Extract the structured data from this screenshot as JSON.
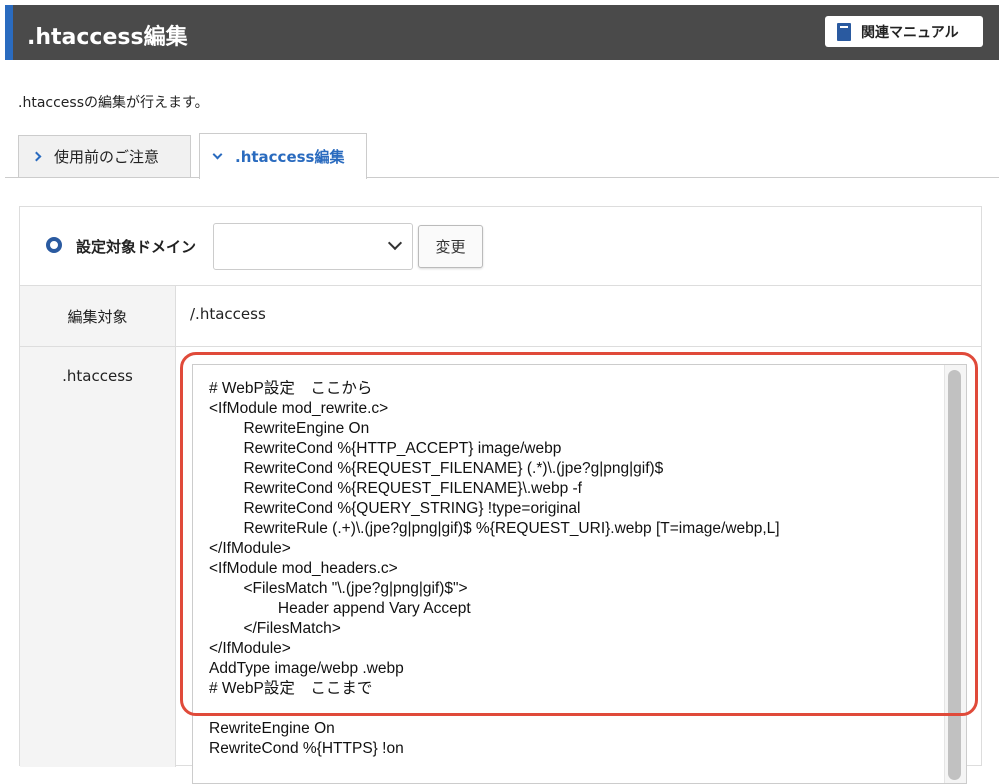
{
  "header": {
    "title": ".htaccess編集",
    "manual_button": "関連マニュアル"
  },
  "description": ".htaccessの編集が行えます。",
  "tabs": [
    {
      "label": "使用前のご注意",
      "active": false
    },
    {
      "label": ".htaccess編集",
      "active": true
    }
  ],
  "form": {
    "domain_label": "設定対象ドメイン",
    "domain_select_value": "",
    "change_button": "変更",
    "target_label": "編集対象",
    "target_value": "/.htaccess",
    "htaccess_label": ".htaccess"
  },
  "editor": {
    "content": "# WebP設定　ここから\n<IfModule mod_rewrite.c>\n        RewriteEngine On\n        RewriteCond %{HTTP_ACCEPT} image/webp\n        RewriteCond %{REQUEST_FILENAME} (.*)\\.(jpe?g|png|gif)$\n        RewriteCond %{REQUEST_FILENAME}\\.webp -f\n        RewriteCond %{QUERY_STRING} !type=original\n        RewriteRule (.+)\\.(jpe?g|png|gif)$ %{REQUEST_URI}.webp [T=image/webp,L]\n</IfModule>\n<IfModule mod_headers.c>\n        <FilesMatch \"\\.(jpe?g|png|gif)$\">\n                Header append Vary Accept\n        </FilesMatch>\n</IfModule>\nAddType image/webp .webp\n# WebP設定　ここまで\n\nRewriteEngine On\nRewriteCond %{HTTPS} !on"
  },
  "colors": {
    "header_bg": "#4a4a4a",
    "accent": "#2a6bbf",
    "highlight": "#e04a3a"
  }
}
